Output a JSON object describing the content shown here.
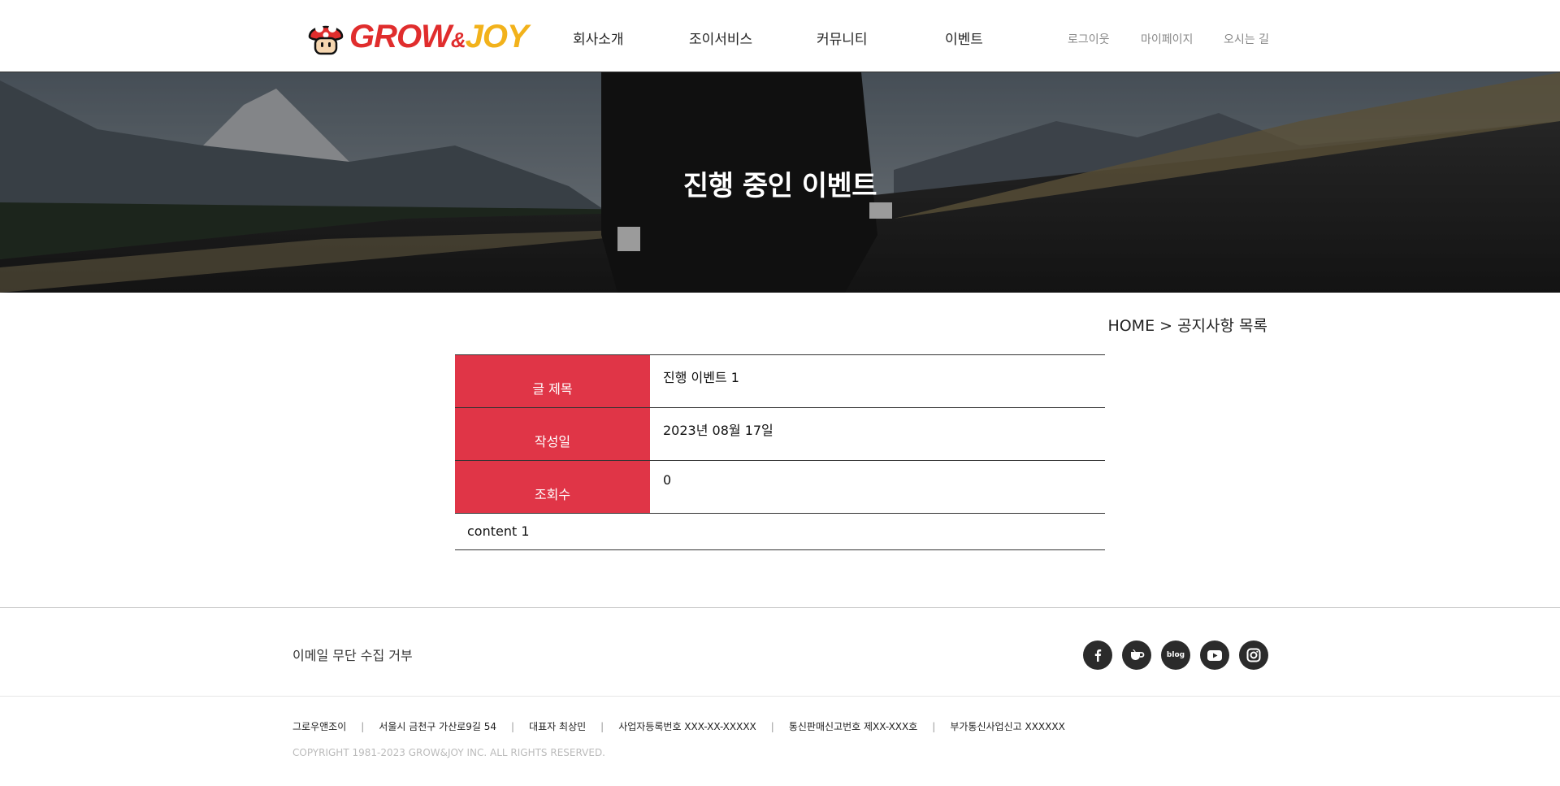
{
  "header": {
    "logo_text_grow": "GROW",
    "logo_text_amp": "&",
    "logo_text_joy": "JOY",
    "nav": [
      "회사소개",
      "조이서비스",
      "커뮤니티",
      "이벤트"
    ],
    "util": [
      "로그이웃",
      "마이페이지",
      "오시는 길"
    ]
  },
  "visual": {
    "title": "진행 중인 이벤트"
  },
  "breadcrumb": "HOME > 공지사항 목록",
  "board": {
    "rows": [
      {
        "label": "글 제목",
        "value": "진행 이벤트 1"
      },
      {
        "label": "작성일",
        "value": "2023년 08월 17일"
      },
      {
        "label": "조회수",
        "value": "0"
      }
    ],
    "content": "content 1"
  },
  "footer": {
    "email_deny": "이메일 무단 수집 거부",
    "sns_icons": [
      "facebook-icon",
      "cafe-icon",
      "blog-icon",
      "youtube-icon",
      "instagram-icon"
    ],
    "blog_label": "blog",
    "info": [
      "그로우앤조이",
      "서울시 금천구 가산로9길 54",
      "대표자 최상민",
      "사업자등록번호 XXX-XX-XXXXX",
      "통신판매신고번호 제XX-XXX호",
      "부가통신사업신고 XXXXXX"
    ],
    "copyright": "COPYRIGHT 1981-2023 GROW&JOY INC. ALL RIGHTS RESERVED."
  },
  "colors": {
    "accent_red": "#e03547",
    "logo_red": "#e02d2d",
    "logo_yellow": "#f2b21b",
    "sns_bg": "#2b2b2b"
  }
}
